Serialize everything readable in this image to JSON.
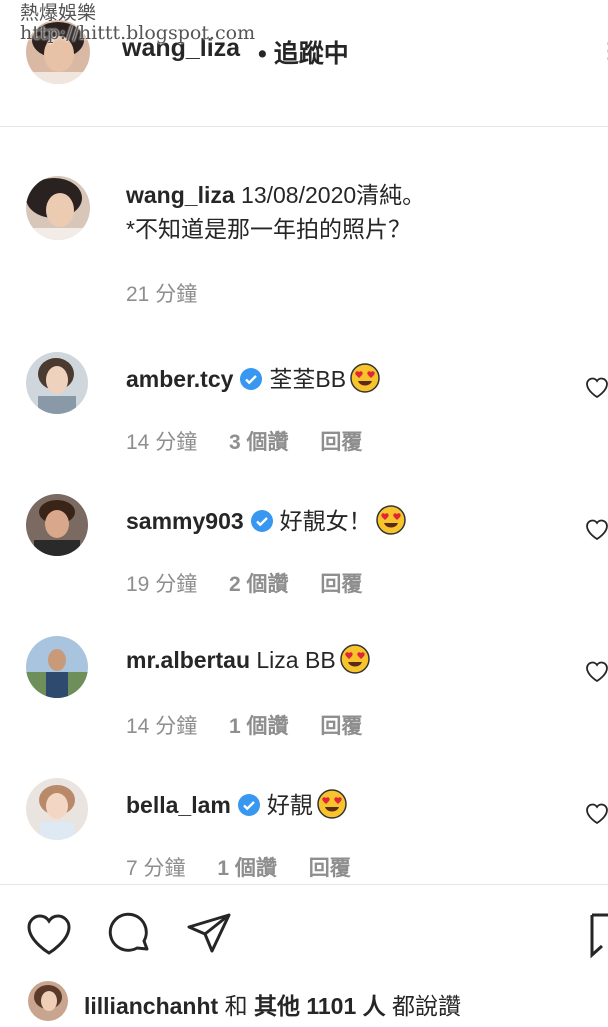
{
  "watermark": {
    "title": "熱爆娛樂",
    "url": "http://hittt.blogspot.com"
  },
  "header": {
    "username": "wang_liza",
    "follow_label": "• 追蹤中"
  },
  "caption": {
    "username": "wang_liza",
    "text_line1": "13/08/2020清純。",
    "text_line2": "*不知道是那一年拍的照片？",
    "time": "21 分鐘"
  },
  "comments": [
    {
      "username": "amber.tcy",
      "verified": true,
      "text": "荃荃BB",
      "emoji": "heart-eyes",
      "time": "14 分鐘",
      "likes": "3 個讚",
      "reply": "回覆"
    },
    {
      "username": "sammy903",
      "verified": true,
      "text": "好靚女！",
      "emoji": "heart-eyes",
      "time": "19 分鐘",
      "likes": "2 個讚",
      "reply": "回覆"
    },
    {
      "username": "mr.albertau",
      "verified": false,
      "text": "Liza BB",
      "emoji": "heart-eyes",
      "time": "14 分鐘",
      "likes": "1 個讚",
      "reply": "回覆"
    },
    {
      "username": "bella_lam",
      "verified": true,
      "text": "好靚",
      "emoji": "heart-eyes",
      "time": "7 分鐘",
      "likes": "1 個讚",
      "reply": "回覆"
    }
  ],
  "footer": {
    "liked_by_user": "lillianchanht",
    "liked_by_and": "和",
    "liked_by_others": "其他 1101 人",
    "liked_by_suffix": "都說讚"
  },
  "colors": {
    "verified": "#3897f0",
    "secondary_text": "#8e8e8e",
    "primary_text": "#262626"
  }
}
